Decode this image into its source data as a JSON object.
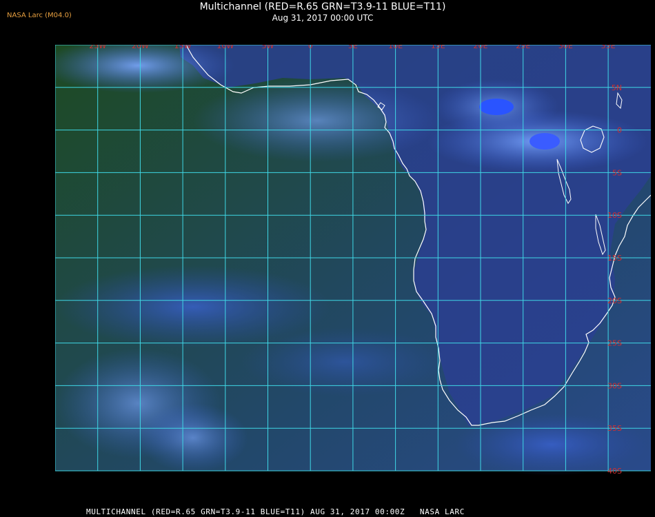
{
  "header": {
    "agency_label": "NASA Larc (M04.0)",
    "title": "Multichannel (RED=R.65 GRN=T3.9-11 BLUE=T11)",
    "datetime": "Aug 31, 2017 00:00 UTC"
  },
  "map": {
    "longitude_labels": [
      "25W",
      "20W",
      "15W",
      "10W",
      "5W",
      "0",
      "5E",
      "10E",
      "15E",
      "20E",
      "25E",
      "30E",
      "35E"
    ],
    "latitude_labels": [
      "5N",
      "0",
      "5S",
      "10S",
      "15S",
      "20S",
      "25S",
      "30S",
      "35S",
      "40S"
    ],
    "colors": {
      "grid": "#3fd8e6",
      "label": "#d03030",
      "coastline": "#ffffff",
      "ocean": "#1f4a26",
      "land": "#2b3d8a",
      "cloud": "#4f84ff"
    }
  },
  "footer": {
    "caption": "MULTICHANNEL (RED=R.65 GRN=T3.9-11 BLUE=T11) AUG 31, 2017 00:00Z   NASA LARC"
  }
}
